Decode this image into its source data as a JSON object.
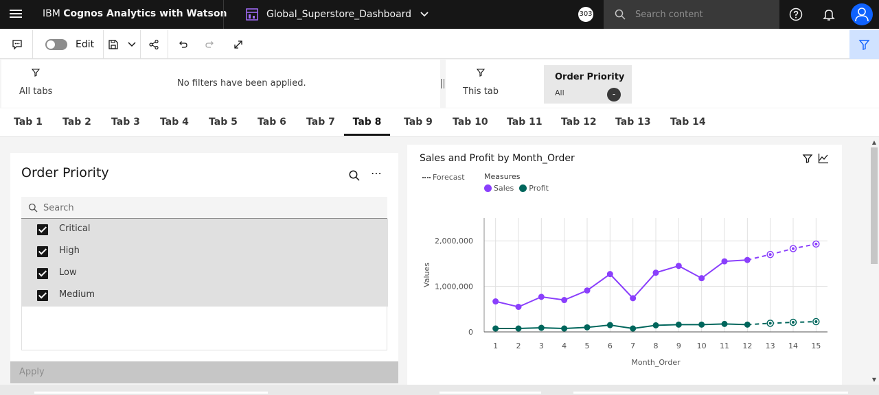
{
  "header": {
    "brand_prefix": "IBM ",
    "brand_bold": "Cognos Analytics with Watson",
    "dashboard_name": "Global_Superstore_Dashboard",
    "notification_count": "303",
    "search_placeholder": "Search content"
  },
  "toolbar": {
    "edit_label": "Edit"
  },
  "filters": {
    "all_tabs_label": "All tabs",
    "empty_message": "No filters have been applied.",
    "this_tab_label": "This tab",
    "card": {
      "title": "Order Priority",
      "value": "All",
      "clear_symbol": "-"
    }
  },
  "tabs": [
    {
      "label": "Tab 1"
    },
    {
      "label": "Tab 2"
    },
    {
      "label": "Tab 3"
    },
    {
      "label": "Tab 4"
    },
    {
      "label": "Tab 5"
    },
    {
      "label": "Tab 6"
    },
    {
      "label": "Tab 7"
    },
    {
      "label": "Tab 8",
      "active": true
    },
    {
      "label": "Tab 9"
    },
    {
      "label": "Tab 10"
    },
    {
      "label": "Tab 11"
    },
    {
      "label": "Tab 12"
    },
    {
      "label": "Tab 13"
    },
    {
      "label": "Tab 14"
    }
  ],
  "filter_widget": {
    "title": "Order Priority",
    "search_placeholder": "Search",
    "more_symbol": "⋯",
    "items": [
      {
        "label": "Critical",
        "checked": true
      },
      {
        "label": "High",
        "checked": true
      },
      {
        "label": "Low",
        "checked": true
      },
      {
        "label": "Medium",
        "checked": true
      }
    ],
    "apply_label": "Apply"
  },
  "chart_widget": {
    "title": "Sales and Profit by Month_Order",
    "forecast_label": "Forecast",
    "measures_label": "Measures"
  },
  "chart_data": {
    "type": "line",
    "xlabel": "Month_Order",
    "ylabel": "Values",
    "x": [
      1,
      2,
      3,
      4,
      5,
      6,
      7,
      8,
      9,
      10,
      11,
      12,
      13,
      14,
      15
    ],
    "forecast_from_x": 13,
    "ylim": [
      0,
      2500000
    ],
    "yticks": [
      0,
      1000000,
      2000000
    ],
    "ytick_labels": [
      "0",
      "1,000,000",
      "2,000,000"
    ],
    "grid": true,
    "legend_position": "top-left",
    "series": [
      {
        "name": "Sales",
        "color": "#8a3ffc",
        "values": [
          670000,
          550000,
          770000,
          700000,
          910000,
          1270000,
          740000,
          1300000,
          1450000,
          1180000,
          1550000,
          1580000,
          1700000,
          1830000,
          1930000
        ]
      },
      {
        "name": "Profit",
        "color": "#00665c",
        "values": [
          75000,
          75000,
          90000,
          75000,
          100000,
          150000,
          75000,
          145000,
          160000,
          160000,
          175000,
          160000,
          190000,
          210000,
          225000
        ]
      }
    ]
  },
  "colors": {
    "header_bg": "#161616",
    "accent": "#0f62fe",
    "sales": "#8a3ffc",
    "profit": "#00665c",
    "dashboard_icon": "#a56eff"
  }
}
